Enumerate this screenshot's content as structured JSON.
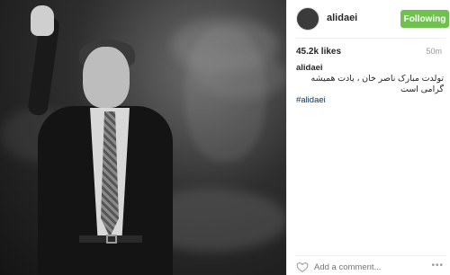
{
  "post": {
    "username": "alidaei",
    "follow_label": "Following",
    "likes": "45.2k likes",
    "time_ago": "50m",
    "caption": {
      "username": "alidaei",
      "text": "تولدت مبارک ناصر خان ، یادت همیشه گرامی است",
      "hashtag": "#alidaei"
    },
    "comment_placeholder": "Add a comment...",
    "more_label": "•••"
  },
  "colors": {
    "follow_button": "#70c050",
    "hashtag": "#003569"
  }
}
